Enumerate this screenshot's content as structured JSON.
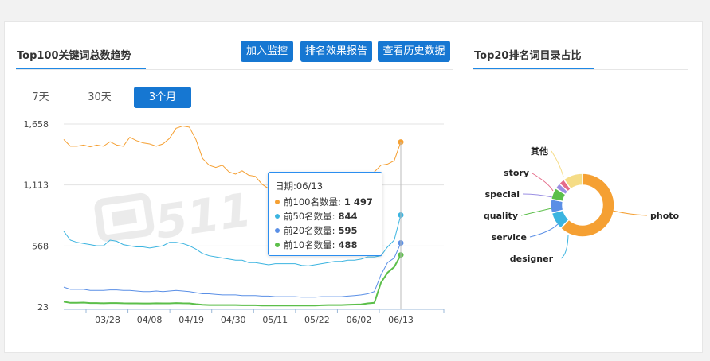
{
  "left_panel": {
    "title": "Top100关键词总数趋势",
    "buttons": [
      "加入监控",
      "排名效果报告",
      "查看历史数据"
    ],
    "ranges": [
      "7天",
      "30天",
      "3个月"
    ],
    "active_range": 2
  },
  "right_panel": {
    "title": "Top20排名词目录占比"
  },
  "watermark": "511",
  "tooltip": {
    "date": "日期:06/13",
    "rows": [
      {
        "label": "前100名数量:",
        "value": "1 497",
        "color": "#f5a033"
      },
      {
        "label": "前50名数量:",
        "value": "844",
        "color": "#3bb4e0"
      },
      {
        "label": "前20名数量:",
        "value": "595",
        "color": "#5a8fe6"
      },
      {
        "label": "前10名数量:",
        "value": "488",
        "color": "#5cbf4a"
      }
    ]
  },
  "chart_data": [
    {
      "type": "line",
      "x_tick_labels": [
        "03/28",
        "04/08",
        "04/19",
        "04/30",
        "05/11",
        "05/22",
        "06/02",
        "06/13"
      ],
      "y_tick_labels": [
        "23",
        "568",
        "1,113",
        "1,658"
      ],
      "ylim": [
        23,
        1658
      ],
      "grid": true,
      "series": [
        {
          "name": "前100名数量",
          "color": "#f5a033",
          "values": [
            1520,
            1460,
            1460,
            1470,
            1455,
            1470,
            1460,
            1500,
            1470,
            1460,
            1540,
            1510,
            1490,
            1480,
            1460,
            1480,
            1530,
            1620,
            1640,
            1630,
            1520,
            1350,
            1290,
            1270,
            1290,
            1230,
            1210,
            1240,
            1200,
            1190,
            1120,
            1080,
            1090,
            1130,
            1140,
            1150,
            1110,
            1080,
            1090,
            1100,
            1140,
            1180,
            1090,
            1150,
            1110,
            1170,
            1090,
            1230,
            1290,
            1300,
            1330,
            1497
          ]
        },
        {
          "name": "前50名数量",
          "color": "#3bb4e0",
          "values": [
            700,
            620,
            600,
            590,
            580,
            570,
            570,
            620,
            610,
            580,
            570,
            560,
            560,
            550,
            560,
            570,
            600,
            600,
            590,
            570,
            540,
            500,
            480,
            470,
            460,
            450,
            440,
            440,
            420,
            420,
            410,
            400,
            410,
            410,
            410,
            410,
            395,
            390,
            400,
            410,
            420,
            430,
            430,
            440,
            440,
            450,
            470,
            470,
            480,
            560,
            620,
            844
          ]
        },
        {
          "name": "前20名数量",
          "color": "#5a8fe6",
          "values": [
            200,
            180,
            180,
            180,
            170,
            170,
            170,
            175,
            175,
            170,
            170,
            165,
            160,
            160,
            165,
            160,
            165,
            170,
            165,
            160,
            150,
            140,
            140,
            135,
            130,
            130,
            130,
            125,
            125,
            125,
            120,
            120,
            115,
            115,
            115,
            115,
            110,
            110,
            110,
            115,
            115,
            115,
            115,
            120,
            125,
            130,
            140,
            160,
            310,
            420,
            460,
            595
          ]
        },
        {
          "name": "前10名数量",
          "color": "#5cbf4a",
          "values": [
            70,
            60,
            60,
            62,
            58,
            58,
            56,
            58,
            58,
            56,
            55,
            55,
            54,
            54,
            56,
            55,
            55,
            58,
            56,
            55,
            48,
            42,
            40,
            40,
            40,
            40,
            40,
            38,
            38,
            38,
            36,
            36,
            36,
            36,
            36,
            36,
            36,
            36,
            36,
            38,
            40,
            40,
            40,
            42,
            44,
            46,
            55,
            60,
            240,
            330,
            380,
            488
          ]
        }
      ]
    },
    {
      "type": "pie",
      "labels": [
        "photo",
        "designer",
        "service",
        "quality",
        "special",
        "story",
        "其他"
      ],
      "values": [
        62,
        9,
        7,
        6,
        3,
        3,
        10
      ],
      "colors": [
        "#f5a033",
        "#3bb4e0",
        "#5a8fe6",
        "#5cbf4a",
        "#9b8fe3",
        "#e56c8a",
        "#f5dc86"
      ]
    }
  ]
}
